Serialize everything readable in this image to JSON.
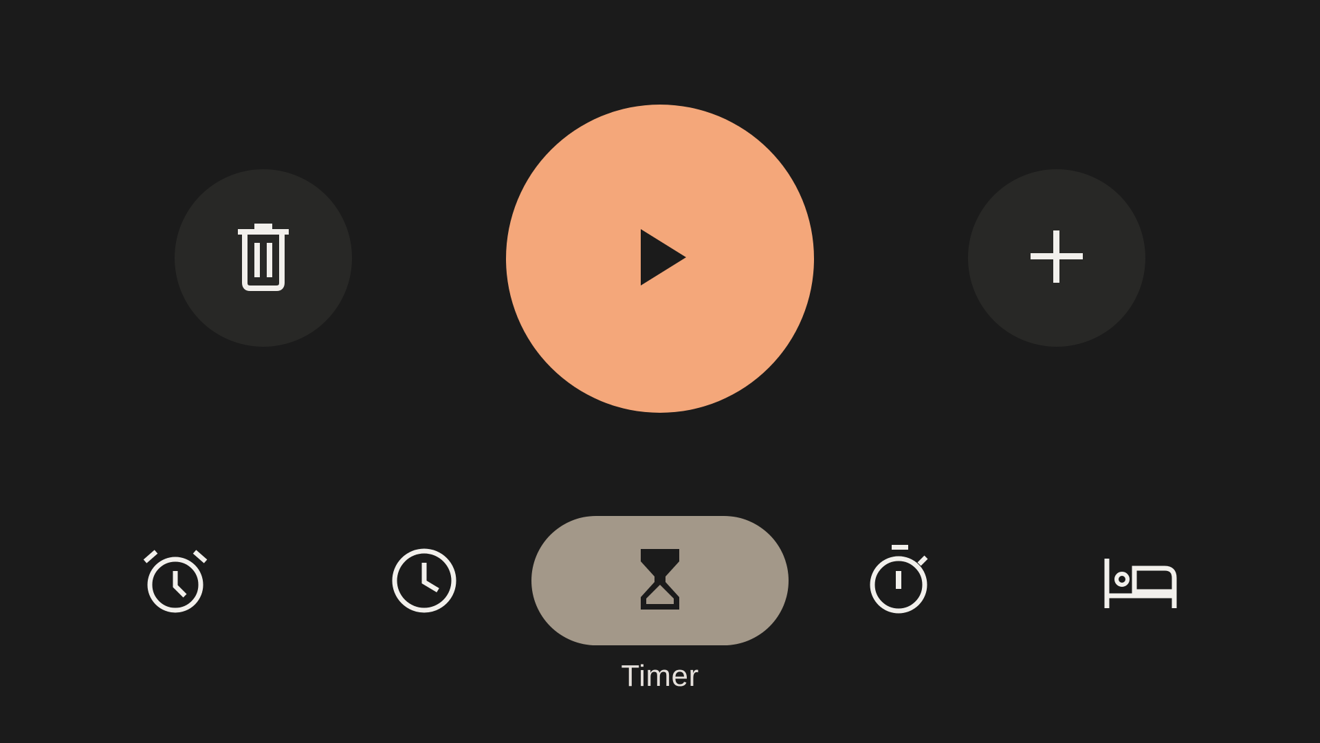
{
  "controls": {
    "delete_icon": "trash-icon",
    "play_icon": "play-icon",
    "add_icon": "plus-icon",
    "play_color": "#f4a77a",
    "side_button_color": "#282826"
  },
  "nav": {
    "items": [
      {
        "icon": "alarm-icon",
        "label": ""
      },
      {
        "icon": "clock-icon",
        "label": ""
      },
      {
        "icon": "hourglass-icon",
        "label": "Timer",
        "active": true
      },
      {
        "icon": "stopwatch-icon",
        "label": ""
      },
      {
        "icon": "bed-icon",
        "label": ""
      }
    ],
    "active_color": "#a39889",
    "label_color": "#e6e1dc"
  },
  "theme": {
    "background": "#1b1b1b",
    "icon_color": "#f2f0ec"
  }
}
